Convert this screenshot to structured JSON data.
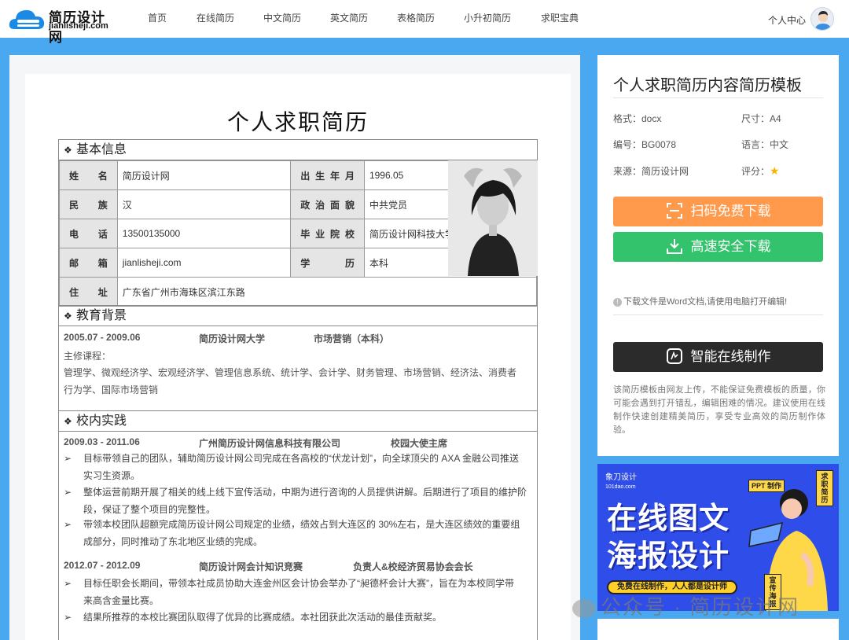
{
  "header": {
    "logo_title": "简历设计网",
    "logo_sub": "jianlisheji.com",
    "nav": [
      "首页",
      "在线简历",
      "中文简历",
      "英文简历",
      "表格简历",
      "小升初简历",
      "求职宝典"
    ],
    "user_center": "个人中心"
  },
  "resume": {
    "title": "个人求职简历",
    "sections": {
      "basic": "基本信息",
      "education": "教育背景",
      "practice": "校内实践"
    },
    "basic_info": {
      "name_label": "姓名",
      "name": "简历设计网",
      "birth_label": "出生年月",
      "birth": "1996.05",
      "ethnic_label": "民族",
      "ethnic": "汉",
      "politics_label": "政治面貌",
      "politics": "中共党员",
      "phone_label": "电话",
      "phone": "13500135000",
      "school_label": "毕业院校",
      "school": "简历设计网科技大学",
      "email_label": "邮箱",
      "email": "jianlisheji.com",
      "degree_label": "学历",
      "degree": "本科",
      "address_label": "住址",
      "address": "广东省广州市海珠区滨江东路"
    },
    "education": {
      "period": "2005.07 - 2009.06",
      "school": "简历设计网大学",
      "major": "市场营销（本科）",
      "courses_label": "主修课程：",
      "courses_line1": "管理学、微观经济学、宏观经济学、管理信息系统、统计学、会计学、财务管理、市场营销、经济法、消费者",
      "courses_line2": "行为学、国际市场营销"
    },
    "practice": [
      {
        "period": "2009.03 - 2011.06",
        "org": "广州简历设计网信息科技有限公司",
        "role": "校园大使主席",
        "bullets": [
          [
            "目标带领自己的团队，辅助简历设计网公司完成在各高校的“伏龙计划”，向全球顶尖的 AXA 金融公司推送",
            "实习生资源。"
          ],
          [
            "整体运营前期开展了相关的线上线下宣传活动，中期为进行咨询的人员提供讲解。后期进行了项目的维护阶",
            "段，保证了整个项目的完整性。"
          ],
          [
            "带领本校团队超额完成简历设计网公司规定的业绩，绩效占到大连区的 30%左右，是大连区绩效的重要组",
            "成部分，同时推动了东北地区业绩的完成。"
          ]
        ]
      },
      {
        "period": "2012.07 - 2012.09",
        "org": "简历设计网会计知识竞赛",
        "role": "负责人&校经济贸易协会会长",
        "bullets": [
          [
            "目标任职会长期间，带领本社成员协助大连金州区会计协会举办了“昶德杯会计大赛”，旨在为本校同学带",
            "来高含金量比赛。"
          ],
          [
            "结果所推荐的本校比赛团队取得了优异的比赛成绩。本社团获此次活动的最佳贡献奖。",
            ""
          ]
        ]
      }
    ]
  },
  "sidebar": {
    "title": "个人求职简历内容简历模板",
    "format": "格式：docx",
    "size": "尺寸：A4",
    "code": "编号：BG0078",
    "language": "语言：中文",
    "source": "来源：简历设计网",
    "rating_label": "评分：",
    "rating": 1,
    "scan_download": "扫码免费下载",
    "fast_download": "高速安全下载",
    "note": "下载文件是Word文档,请使用电脑打开编辑!",
    "online_make": "智能在线制作",
    "desc": "该简历模板由网友上传，不能保证免费模板的质量，你可能会遇到打开错乱，编辑困难的情况。建议使用在线制作快速创建精美简历，享受专业高效的简历制作体验。"
  },
  "ad": {
    "brand": "象刀设计",
    "brand_url": "101dao.com",
    "line1": "在线图文",
    "line2": "海报设计",
    "pill": "免费在线制作，人人都是设计师",
    "tag1": "PPT 制作",
    "tag2": "求职 简历",
    "tag3": "宣传 海报"
  },
  "watermark": "公众号 · 简历设计网",
  "colors": {
    "background": "#4aa8f0",
    "orange": "#ff9a4d",
    "green": "#34c36d",
    "dark": "#2b2b2b",
    "ad": "#2f4de8"
  }
}
